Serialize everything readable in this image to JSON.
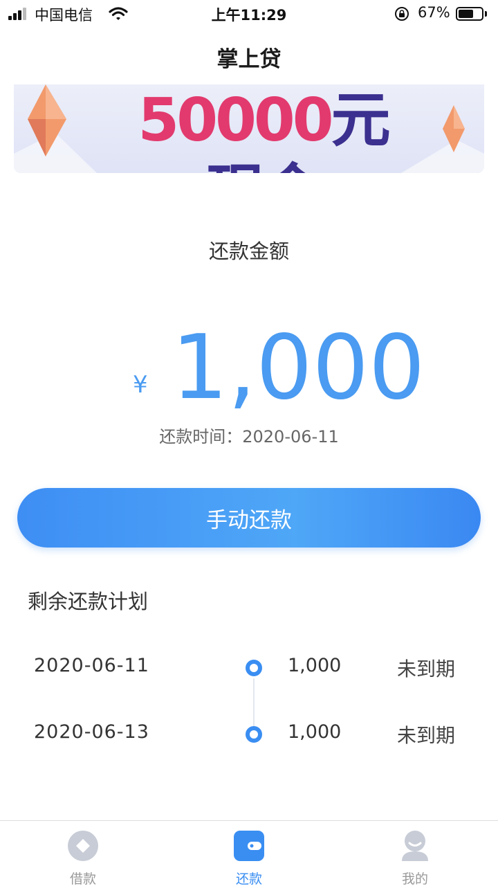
{
  "status_bar": {
    "carrier": "中国电信",
    "time": "上午11:29",
    "battery_percent": "67%",
    "battery_level": 0.67
  },
  "header": {
    "title": "掌上贷"
  },
  "banner": {
    "amount_text": "50000",
    "text": "元现金"
  },
  "repayment": {
    "label": "还款金额",
    "currency": "¥",
    "amount": "1,000",
    "due_label": "还款时间：",
    "due_date": "2020-06-11"
  },
  "action": {
    "repay_button": "手动还款"
  },
  "plan": {
    "title": "剩余还款计划",
    "items": [
      {
        "date": "2020-06-11",
        "amount": "1,000",
        "status": "未到期"
      },
      {
        "date": "2020-06-13",
        "amount": "1,000",
        "status": "未到期"
      }
    ]
  },
  "tabs": [
    {
      "label": "借款",
      "icon": "loan-icon",
      "active": false
    },
    {
      "label": "还款",
      "icon": "wallet-icon",
      "active": true
    },
    {
      "label": "我的",
      "icon": "user-icon",
      "active": false
    }
  ],
  "colors": {
    "accent": "#3a8ef2",
    "amount_blue": "#4a9bf1",
    "banner_pink": "#e23a6e",
    "banner_purple": "#3b2f8f",
    "inactive_tab": "#c7ccd6"
  }
}
